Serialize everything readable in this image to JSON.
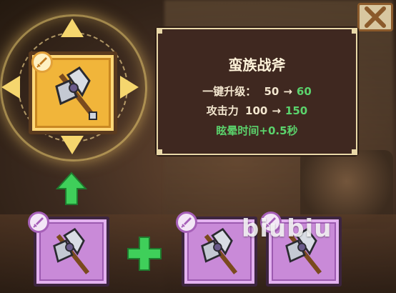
{
  "item": {
    "name": "蛮族战斧",
    "level_label": "一键升级：",
    "level_from": "50",
    "level_to": "60",
    "attack_label": "攻击力",
    "attack_from": "100",
    "attack_to": "150",
    "effect": "眩晕时间+0.5秒",
    "arrow": "→"
  },
  "materials": {
    "count": 3,
    "combine_icon": "plus-icon"
  },
  "watermark": "biubiu",
  "colors": {
    "green": "#5bd36c",
    "gold_frame": "#f1b53a",
    "purple_frame": "#c98ad8",
    "panel_bg": "#3f2820"
  }
}
